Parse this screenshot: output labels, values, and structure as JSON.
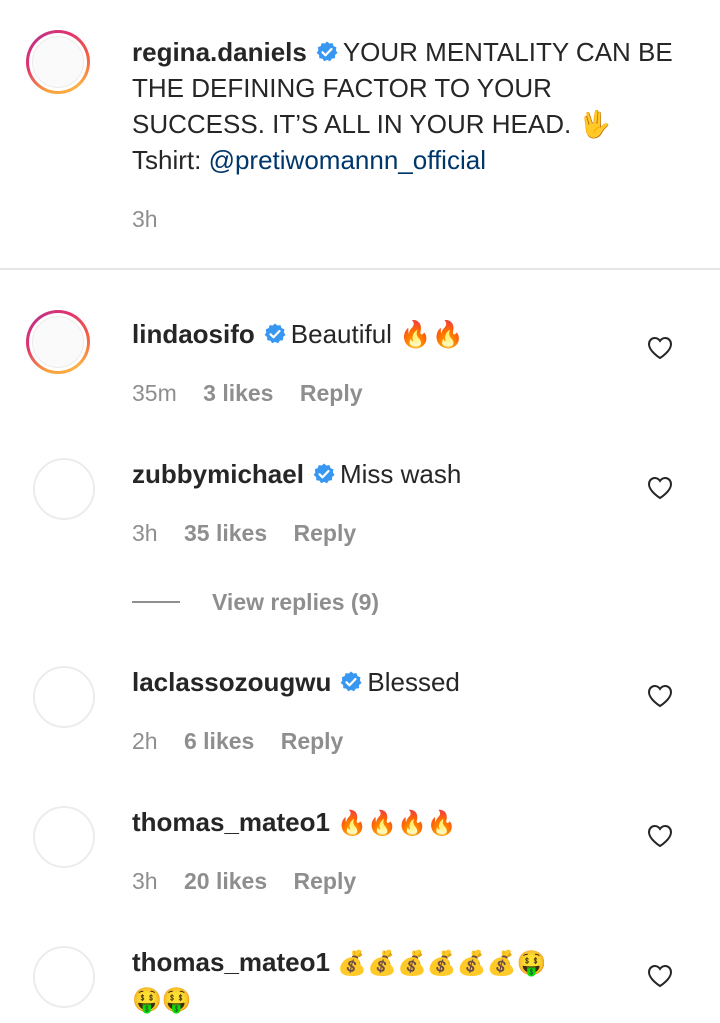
{
  "caption": {
    "username": "regina.daniels",
    "text": "YOUR MENTALITY CAN BE THE DEFINING FACTOR TO YOUR SUCCESS. IT’S ALL IN YOUR HEAD. 🖖",
    "tshirt_label": "Tshirt: ",
    "mention": "@pretiwomannn_official",
    "time": "3h"
  },
  "comments": [
    {
      "username": "lindaosifo",
      "verified": true,
      "text": "Beautiful 🔥🔥",
      "time": "35m",
      "likes": "3 likes",
      "reply": "Reply"
    },
    {
      "username": "zubbymichael",
      "verified": true,
      "text": "Miss wash",
      "time": "3h",
      "likes": "35 likes",
      "reply": "Reply"
    },
    {
      "username": "laclassozougwu",
      "verified": true,
      "text": "Blessed",
      "time": "2h",
      "likes": "6 likes",
      "reply": "Reply"
    },
    {
      "username": "thomas_mateo1",
      "verified": false,
      "text": "🔥🔥🔥🔥",
      "time": "3h",
      "likes": "20 likes",
      "reply": "Reply"
    },
    {
      "username": "thomas_mateo1",
      "verified": false,
      "text": "💰💰💰💰💰💰🤑",
      "text_line2": "🤑🤑"
    }
  ],
  "view_replies": "View replies (9)",
  "colors": {
    "verified_badge": "#3897f0",
    "text": "#262626",
    "meta": "#8e8e8e",
    "mention": "#00376b"
  }
}
